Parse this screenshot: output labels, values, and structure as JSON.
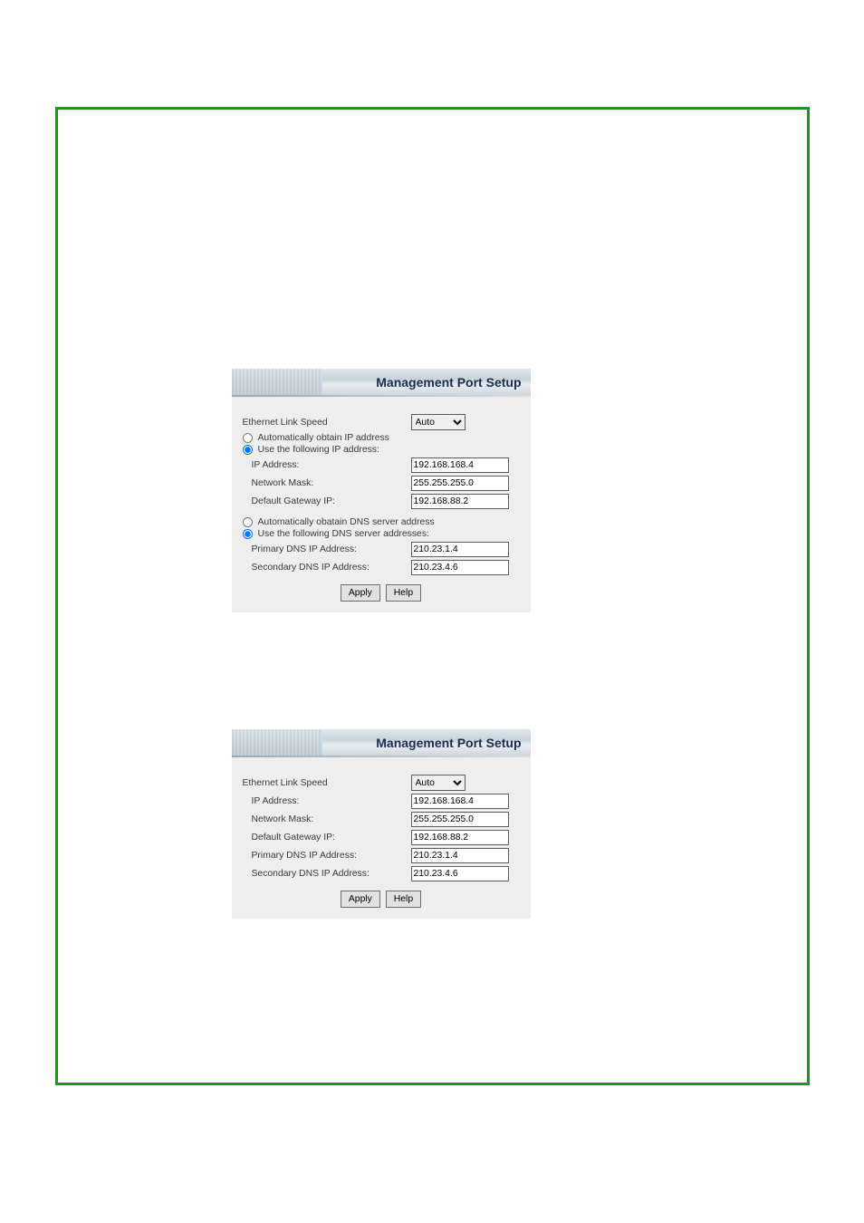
{
  "panel1": {
    "title": "Management Port Setup",
    "ethernet_label": "Ethernet Link Speed",
    "ethernet_value": "Auto",
    "radio_auto_ip": "Automatically obtain IP address",
    "radio_use_ip": "Use the following IP address:",
    "ip_addr_label": "IP Address:",
    "ip_addr_value": "192.168.168.4",
    "netmask_label": "Network Mask:",
    "netmask_value": "255.255.255.0",
    "gateway_label": "Default Gateway IP:",
    "gateway_value": "192.168.88.2",
    "radio_auto_dns": "Automatically obatain DNS server address",
    "radio_use_dns": "Use the following DNS server addresses:",
    "primary_dns_label": "Primary DNS IP Address:",
    "primary_dns_value": "210.23.1.4",
    "secondary_dns_label": "Secondary DNS IP Address:",
    "secondary_dns_value": "210.23.4.6",
    "apply_label": "Apply",
    "help_label": "Help"
  },
  "panel2": {
    "title": "Management Port Setup",
    "ethernet_label": "Ethernet Link Speed",
    "ethernet_value": "Auto",
    "ip_addr_label": "IP Address:",
    "ip_addr_value": "192.168.168.4",
    "netmask_label": "Network Mask:",
    "netmask_value": "255.255.255.0",
    "gateway_label": "Default Gateway IP:",
    "gateway_value": "192.168.88.2",
    "primary_dns_label": "Primary DNS IP Address:",
    "primary_dns_value": "210.23.1.4",
    "secondary_dns_label": "Secondary DNS IP Address:",
    "secondary_dns_value": "210.23.4.6",
    "apply_label": "Apply",
    "help_label": "Help"
  }
}
